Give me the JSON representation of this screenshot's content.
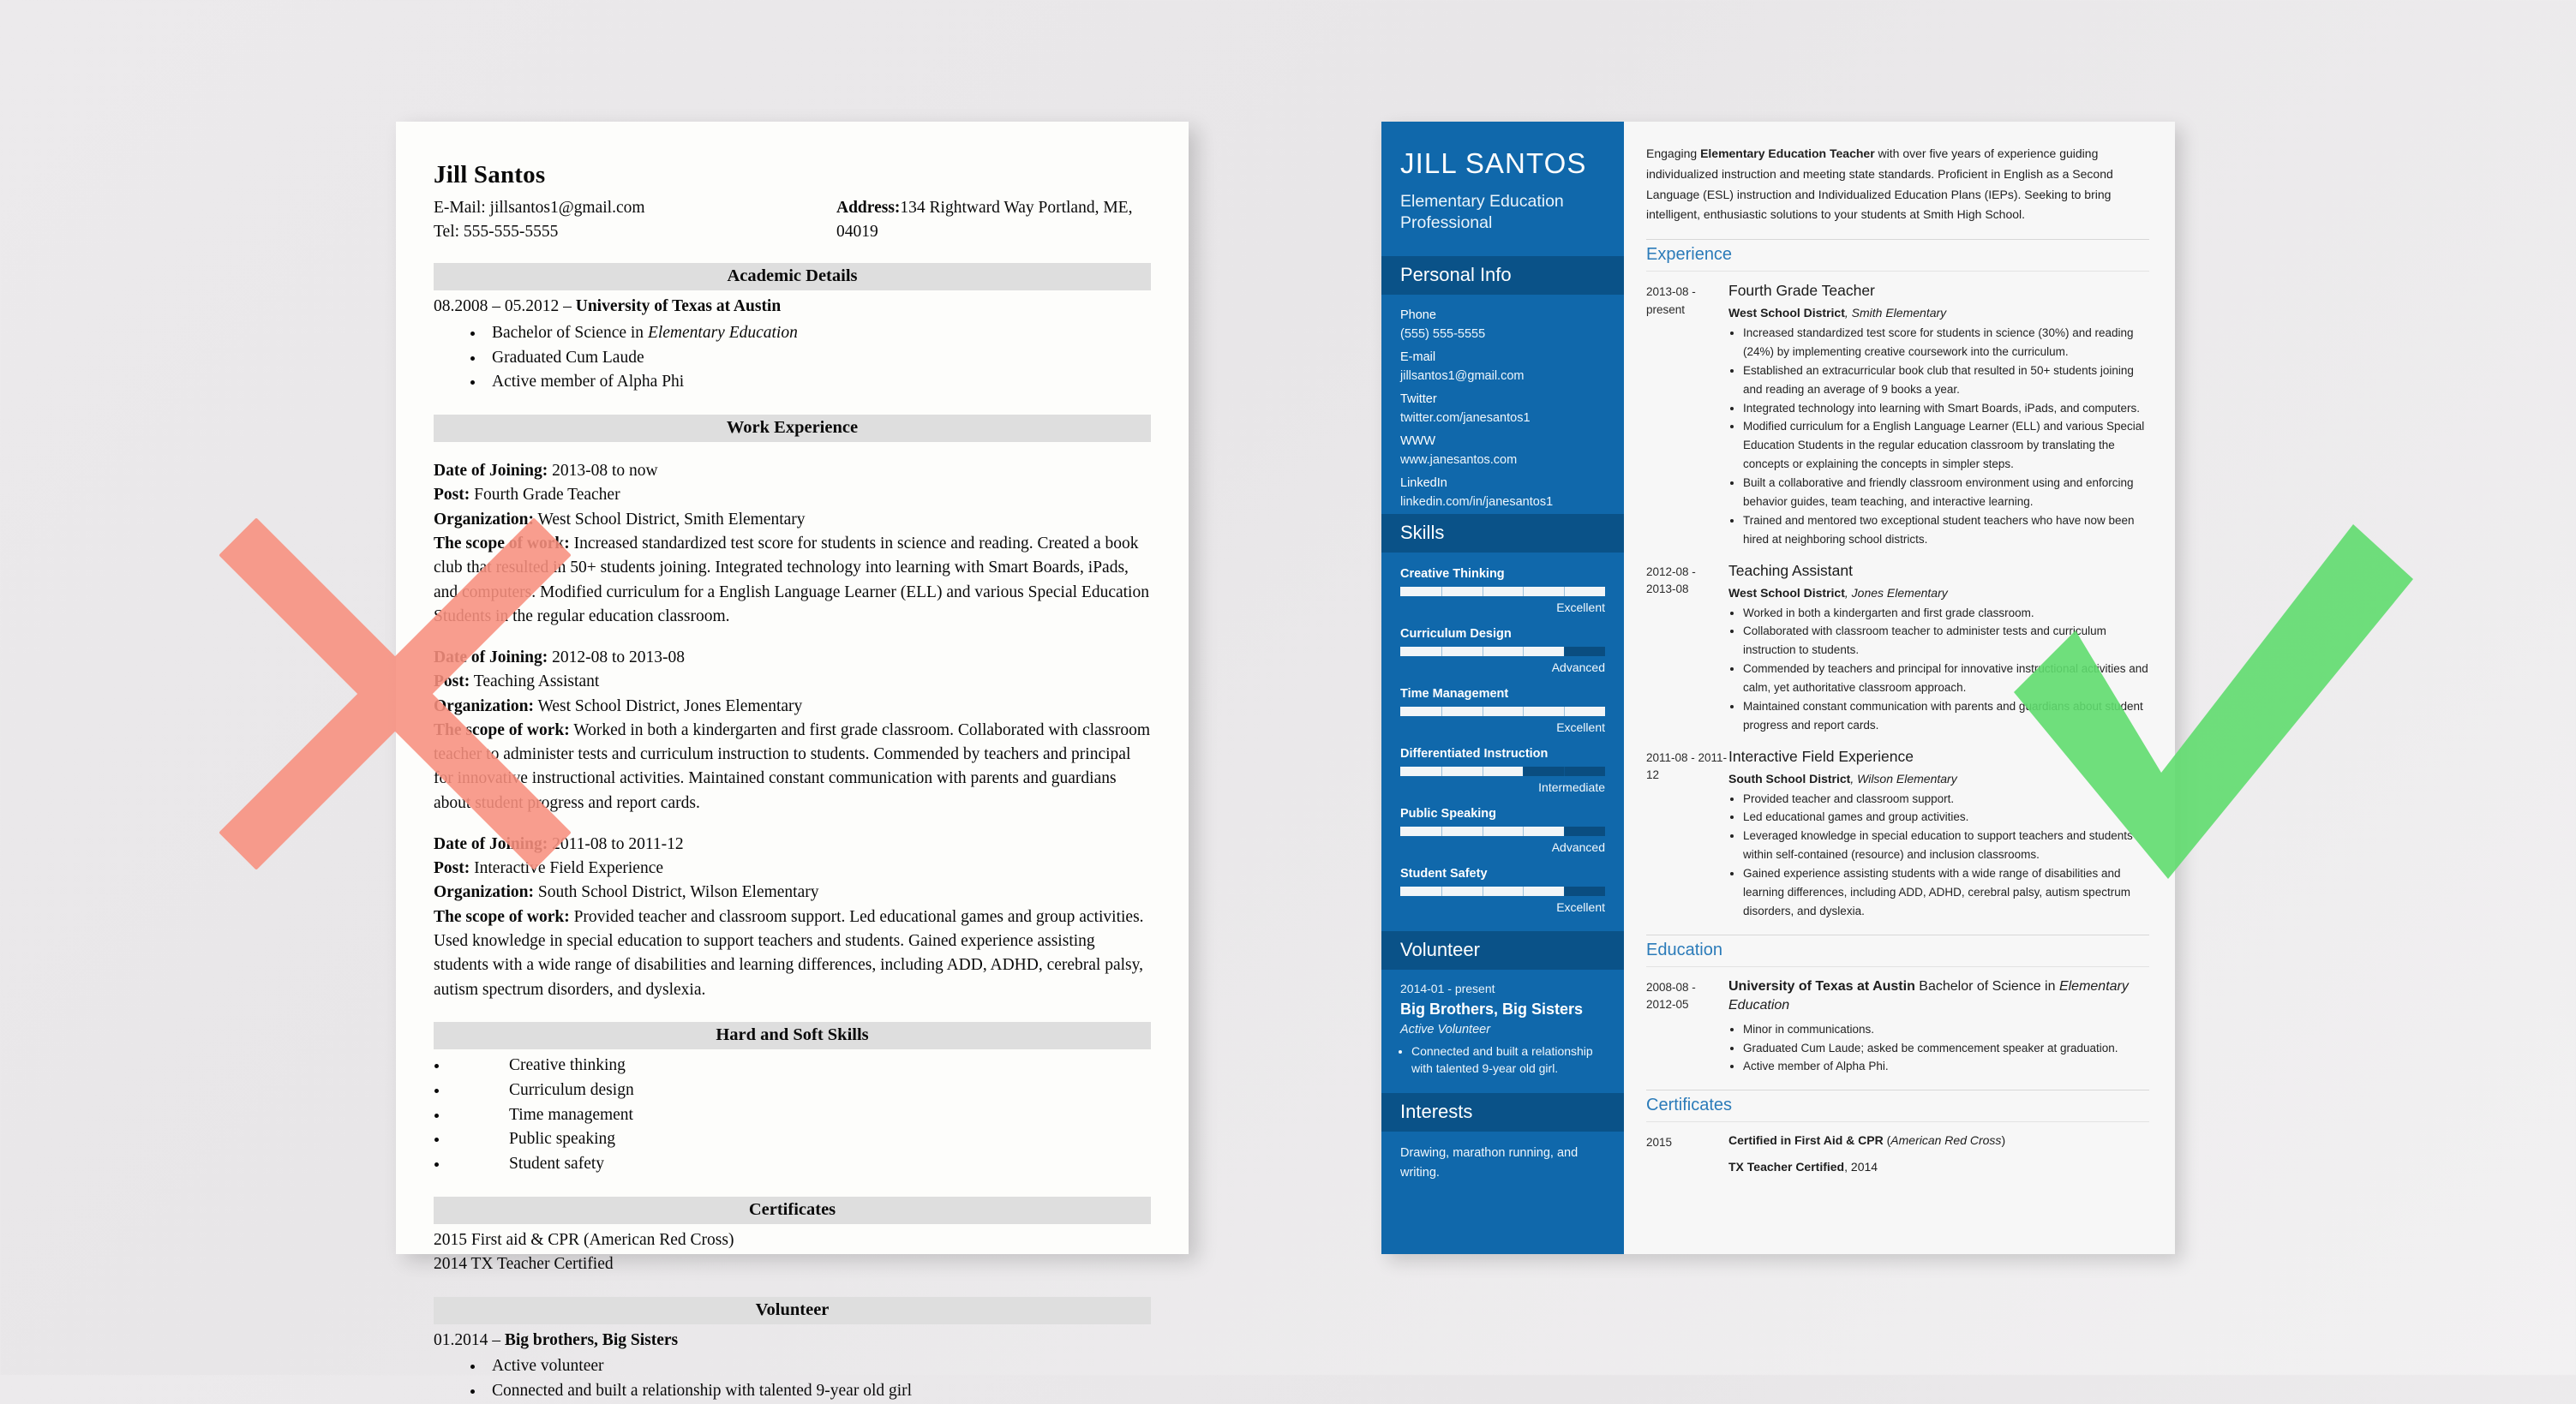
{
  "bad_resume": {
    "name": "Jill Santos",
    "email_line": "E-Mail: jillsantos1@gmail.com",
    "tel_line": "Tel: 555-555-5555",
    "address_label": "Address:",
    "address_value": "134 Rightward Way Portland, ME, 04019",
    "sections": {
      "academic": "Academic Details",
      "work": "Work Experience",
      "skills": "Hard and Soft Skills",
      "certificates": "Certificates",
      "volunteer": "Volunteer"
    },
    "academic": {
      "line": "08.2008 – 05.2012 – ",
      "school": "University of Texas at Austin",
      "bullets_pre": "Bachelor of Science in ",
      "bullets_em": "Elementary Education",
      "bullets": [
        "Graduated Cum Laude",
        "Active member of Alpha Phi"
      ]
    },
    "jobs": [
      {
        "date_label": "Date of Joining:",
        "date_value": " 2013-08 to now",
        "post_label": "Post:",
        "post_value": " Fourth Grade Teacher",
        "org_label": "Organization:",
        "org_value": " West School District, Smith Elementary",
        "scope_label": "The scope of work:",
        "scope_value": " Increased standardized test score for students in science and reading. Created a book club that resulted in 50+ students joining. Integrated technology into learning with Smart Boards, iPads, and computers. Modified curriculum for a English Language Learner (ELL) and various Special Education Students in the regular education classroom."
      },
      {
        "date_label": "Date of Joining:",
        "date_value": " 2012-08 to 2013-08",
        "post_label": "Post:",
        "post_value": " Teaching Assistant",
        "org_label": "Organization:",
        "org_value": " West School District, Jones Elementary",
        "scope_label": "The scope of work:",
        "scope_value": " Worked in both a kindergarten and first grade classroom. Collaborated with classroom teacher to administer tests and curriculum instruction to students. Commended by teachers and principal for innovative instructional activities. Maintained constant communication with parents and guardians about student progress and report cards."
      },
      {
        "date_label": "Date of Joining:",
        "date_value": " 2011-08 to 2011-12",
        "post_label": "Post:",
        "post_value": " Interactive Field Experience",
        "org_label": "Organization:",
        "org_value": " South School District, Wilson Elementary",
        "scope_label": "The scope of work:",
        "scope_value": " Provided teacher and classroom support. Led educational games and group activities. Used knowledge in special education to support teachers and students. Gained experience assisting students with a wide range of disabilities and learning differences, including ADD, ADHD, cerebral palsy, autism spectrum disorders, and dyslexia."
      }
    ],
    "skills": [
      "Creative thinking",
      "Curriculum design",
      "Time management",
      "Public speaking",
      "Student safety"
    ],
    "certificates": [
      "2015 First aid & CPR (American Red Cross)",
      "2014 TX Teacher Certified"
    ],
    "volunteer": {
      "heading_date": "01.2014 – ",
      "heading_org": "Big brothers, Big Sisters",
      "bullets": [
        "Active volunteer",
        "Connected and built a relationship with talented 9-year old girl"
      ]
    }
  },
  "good_resume": {
    "name": "JILL SANTOS",
    "title": "Elementary Education Professional",
    "sidebar": {
      "personal_info_heading": "Personal Info",
      "contacts": [
        {
          "label": "Phone",
          "value": "(555) 555-5555"
        },
        {
          "label": "E-mail",
          "value": "jillsantos1@gmail.com"
        },
        {
          "label": "Twitter",
          "value": "twitter.com/janesantos1"
        },
        {
          "label": "WWW",
          "value": "www.janesantos.com"
        },
        {
          "label": "LinkedIn",
          "value": "linkedin.com/in/janesantos1"
        }
      ],
      "skills_heading": "Skills",
      "skills": [
        {
          "name": "Creative Thinking",
          "level": "Excellent",
          "percent": 100
        },
        {
          "name": "Curriculum Design",
          "level": "Advanced",
          "percent": 80
        },
        {
          "name": "Time Management",
          "level": "Excellent",
          "percent": 100
        },
        {
          "name": "Differentiated Instruction",
          "level": "Intermediate",
          "percent": 60
        },
        {
          "name": "Public Speaking",
          "level": "Advanced",
          "percent": 80
        },
        {
          "name": "Student Safety",
          "level": "Excellent",
          "percent": 80
        }
      ],
      "volunteer_heading": "Volunteer",
      "volunteer": {
        "date": "2014-01 - present",
        "org": "Big Brothers, Big Sisters",
        "role": "Active Volunteer",
        "bullets": [
          "Connected and built a relationship with talented 9-year old girl."
        ]
      },
      "interests_heading": "Interests",
      "interests_text": "Drawing, marathon running, and writing."
    },
    "summary": {
      "pre": "Engaging ",
      "strong": "Elementary Education Teacher",
      "post": " with over five years of experience guiding individualized instruction and meeting state standards. Proficient in English as a Second Language (ESL) instruction and Individualized Education Plans (IEPs). Seeking to bring intelligent, enthusiastic solutions to your students at Smith High School."
    },
    "sections": {
      "experience": "Experience",
      "education": "Education",
      "certificates": "Certificates"
    },
    "experience": [
      {
        "date": "2013-08 - present",
        "role": "Fourth Grade Teacher",
        "org_bold": "West School District",
        "org_italic": ", Smith Elementary",
        "bullets": [
          "Increased standardized test score for students in science (30%) and reading (24%) by implementing creative coursework into the curriculum.",
          "Established an extracurricular book club that resulted in 50+ students joining and reading an average of 9 books a year.",
          "Integrated technology into learning with Smart Boards, iPads, and computers.",
          "Modified curriculum for a English Language Learner (ELL) and various Special Education Students in the regular education classroom by translating the concepts or explaining the concepts in simpler steps.",
          "Built a collaborative and friendly classroom environment using and enforcing behavior guides, team teaching, and interactive learning.",
          "Trained and mentored two exceptional student teachers who have now been hired at neighboring school districts."
        ]
      },
      {
        "date": "2012-08 - 2013-08",
        "role": "Teaching Assistant",
        "org_bold": "West School District",
        "org_italic": ", Jones Elementary",
        "bullets": [
          "Worked in both a kindergarten and first grade classroom.",
          "Collaborated with classroom teacher to administer tests and curriculum instruction to students.",
          "Commended by teachers and principal for innovative instructional activities and calm, yet authoritative classroom approach.",
          "Maintained constant communication with parents and guardians about student progress and report cards."
        ]
      },
      {
        "date": "2011-08 - 2011-12",
        "role": "Interactive Field Experience",
        "org_bold": "South School District",
        "org_italic": ", Wilson Elementary",
        "bullets": [
          "Provided teacher and classroom support.",
          "Led educational games and group activities.",
          "Leveraged knowledge in special education to support teachers and students within self-contained (resource) and inclusion classrooms.",
          "Gained experience assisting students with a wide range of disabilities and learning differences, including ADD, ADHD, cerebral palsy, autism spectrum disorders, and dyslexia."
        ]
      }
    ],
    "education": {
      "date": "2008-08 - 2012-05",
      "school": "University of Texas at Austin",
      "degree": " Bachelor of Science in ",
      "field": "Elementary Education",
      "bullets": [
        "Minor in communications.",
        "Graduated Cum Laude; asked be commencement speaker at graduation.",
        "Active member of Alpha Phi."
      ]
    },
    "certificates": {
      "date": "2015",
      "items": [
        {
          "bold": "Certified in First Aid & CPR ",
          "italic_open": "(",
          "italic": "American Red Cross",
          "italic_close": ")",
          "plain": ""
        },
        {
          "bold": "TX Teacher Certified",
          "italic_open": "",
          "italic": "",
          "italic_close": "",
          "plain": ", 2014"
        }
      ]
    }
  },
  "overlays": {
    "reject_mark": "x-mark-icon",
    "approve_mark": "check-mark-icon",
    "reject_color": "#f8907f",
    "approve_color": "#5fdc6e"
  },
  "colors": {
    "sidebar_blue": "#1068ab",
    "sidebar_heading_blue": "#0a5288",
    "accent_heading": "#2b7bb9",
    "page_background": "#eceaec"
  }
}
